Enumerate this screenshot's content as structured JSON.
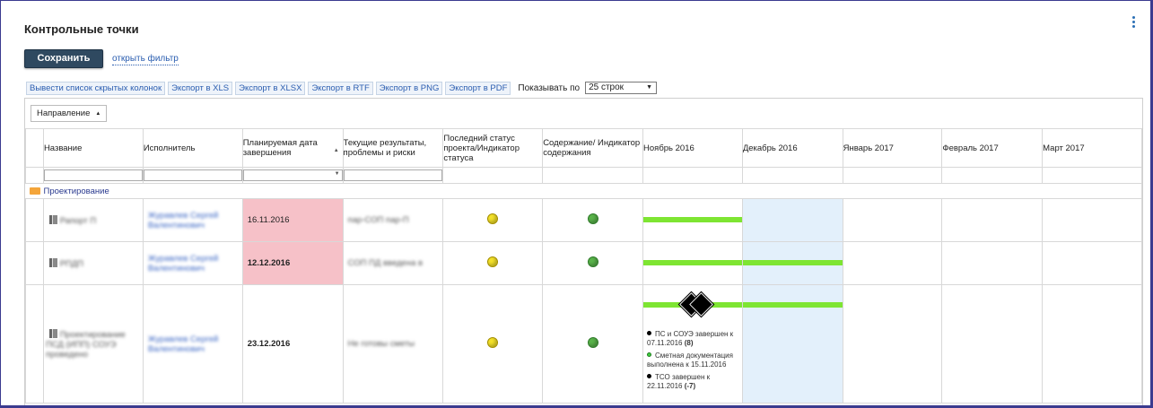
{
  "page": {
    "title": "Контрольные точки"
  },
  "actions": {
    "save_label": "Сохранить",
    "filter_link": "открыть фильтр"
  },
  "toolbar": {
    "buttons": [
      "Вывести список скрытых колонок",
      "Экспорт в XLS",
      "Экспорт в XLSX",
      "Экспорт в RTF",
      "Экспорт в PNG",
      "Экспорт в PDF"
    ],
    "show_label": "Показывать по",
    "rows_value": "25 строк"
  },
  "grid": {
    "group_by_label": "Направление",
    "columns": {
      "name": "Название",
      "executor": "Исполнитель",
      "planned_date": "Планируемая дата завершения",
      "current": "Текущие результаты, проблемы и риски",
      "status": "Последний статус проекта/Индикатор статуса",
      "content": "Содержание/ Индикатор содержания",
      "nov": "Ноябрь 2016",
      "dec": "Декабрь 2016",
      "jan": "Январь 2017",
      "feb": "Февраль 2017",
      "mar": "Март 2017"
    },
    "group_name": "Проектирование",
    "rows": [
      {
        "name": "Рапорт П",
        "executor": "Журавлев Сергей Валентинович",
        "date": "16.11.2016",
        "current": "пар-СОП пар-П",
        "status_color": "yellow",
        "content_color": "green",
        "bar_until": "nov"
      },
      {
        "name": "РПДП",
        "executor": "Журавлев Сергей Валентинович",
        "date": "12.12.2016",
        "current": "СОП ПД введена в",
        "status_color": "yellow",
        "content_color": "green",
        "bar_until": "dec"
      },
      {
        "name": "Проектирование ПСД (ИПП) СОУЭ проведено",
        "executor": "Журавлев Сергей Валентинович",
        "date": "23.12.2016",
        "current": "Не готовы сметы",
        "status_color": "yellow",
        "content_color": "green",
        "bar_until": "dec"
      }
    ],
    "milestones": [
      {
        "text": "ПС и СОУЭ завершен к 07.11.2016",
        "count": "(8)",
        "marker": "black"
      },
      {
        "text": "Сметная документация выполнена к 15.11.2016",
        "count": "",
        "marker": "green"
      },
      {
        "text": "ТСО завершен к 22.11.2016",
        "count": "(-7)",
        "marker": "black"
      }
    ]
  },
  "colors": {
    "accent": "#2f4960",
    "overdue": "#f6c1c8",
    "bar": "#7ee532",
    "current_month": "#e3f0fb"
  }
}
